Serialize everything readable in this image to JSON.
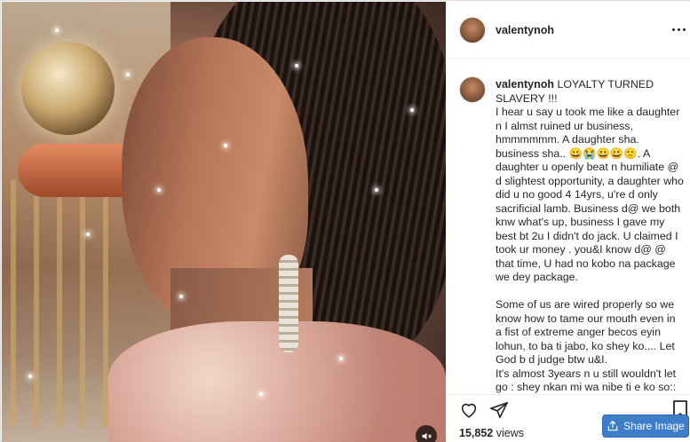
{
  "post": {
    "username": "valentynoh",
    "views_count": "15,852",
    "views_suffix": "views"
  },
  "caption": {
    "username": "valentynoh",
    "paragraphs": [
      "LOYALTY TURNED SLAVERY !!!",
      "I hear u say u took me like a daughter n I almst ruined ur business, hmmmmmm. A daughter sha. business sha.. 😀😭😀😀🙁. A daughter u openly beat n humiliate @ d slightest opportunity, a daughter who did u no good 4 14yrs, u're d only sacrificial lamb. Business d@ we both knw what's up, business I gave my best bt 2u I didn't do jack. U claimed I took ur money . you&I know d@ @ that time, U had no kobo na package we dey package.",
      "",
      "Some of us are wired properly so we know how to tame our mouth even in a fist of extreme anger becos eyin lohun, to ba ti jabo, ko shey ko.... Let God b d judge btw u&I.",
      "It's almost 3years n u still wouldn't let go : shey nkan mi wa nibe ti e ko so::"
    ]
  },
  "share_button": {
    "label": "Share Image"
  },
  "icons": {
    "more": "more-options-icon",
    "like": "heart-icon",
    "share": "send-icon",
    "save": "bookmark-icon",
    "mute": "volume-mute-icon",
    "share_image": "share-icon"
  },
  "colors": {
    "accent": "#3d7dc9",
    "text": "#262626",
    "border": "#dbdbdb"
  }
}
